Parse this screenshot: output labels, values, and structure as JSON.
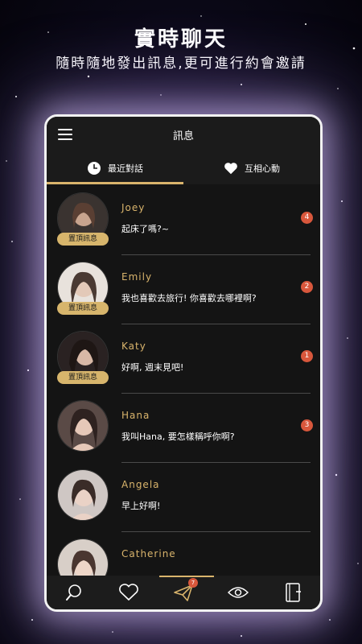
{
  "promo": {
    "title": "實時聊天",
    "subtitle": "隨時隨地發出訊息,更可進行約會邀請"
  },
  "header": {
    "title": "訊息"
  },
  "tabs": [
    {
      "label": "最近對話",
      "icon": "clock-icon",
      "active": true
    },
    {
      "label": "互相心動",
      "icon": "heart-icon",
      "active": false
    }
  ],
  "conversations": [
    {
      "name": "Joey",
      "message": "起床了嗎?~",
      "unread": "4",
      "pinned_label": "置頂訊息",
      "avatar_color": "#c8a48e"
    },
    {
      "name": "Emily",
      "message": "我也喜歡去旅行! 你喜歡去哪裡啊?",
      "unread": "2",
      "pinned_label": "置頂訊息",
      "avatar_color": "#b79682"
    },
    {
      "name": "Katy",
      "message": "好啊, 週末見吧!",
      "unread": "1",
      "pinned_label": "置頂訊息",
      "avatar_color": "#6e4f49"
    },
    {
      "name": "Hana",
      "message": "我叫Hana, 要怎樣稱呼你啊?",
      "unread": "3",
      "pinned_label": "",
      "avatar_color": "#8c6f66"
    },
    {
      "name": "Angela",
      "message": "早上好啊!",
      "unread": "",
      "pinned_label": "",
      "avatar_color": "#a88a80"
    },
    {
      "name": "Catherine",
      "message": "",
      "unread": "",
      "pinned_label": "",
      "avatar_color": "#b99a88"
    }
  ],
  "bottom_nav": [
    {
      "icon": "search-icon",
      "active": false
    },
    {
      "icon": "heart-icon",
      "active": false
    },
    {
      "icon": "paper-plane-icon",
      "active": true,
      "badge": "7"
    },
    {
      "icon": "eye-icon",
      "active": false
    },
    {
      "icon": "notebook-icon",
      "active": false
    }
  ],
  "colors": {
    "accent_gold": "#d9b46c",
    "badge_red": "#d8573c",
    "background": "#141414"
  }
}
